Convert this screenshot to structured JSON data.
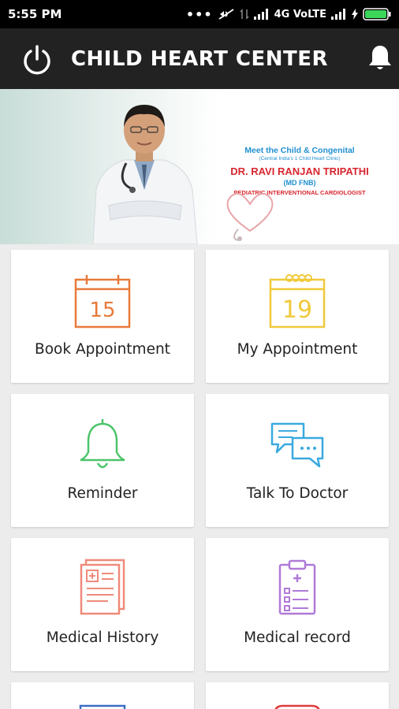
{
  "status_bar": {
    "time": "5:55 PM",
    "network": "4G VoLTE"
  },
  "app_bar": {
    "title": "CHILD HEART CENTER"
  },
  "banner": {
    "line1": "Meet the Child & Congenital",
    "line2": "(Central India's 1 Child Heart Clinic)",
    "doctor_name": "DR. RAVI RANJAN TRIPATHI",
    "qualification": "(MD FNB)",
    "specialty": "PEDIATRIC INTERVENTIONAL CARDIOLOGIST"
  },
  "tiles": [
    {
      "label": "Book Appointment",
      "icon": "calendar-15-icon",
      "icon_text": "15",
      "color": "#e87a3a"
    },
    {
      "label": "My Appointment",
      "icon": "calendar-19-icon",
      "icon_text": "19",
      "color": "#f0c93a"
    },
    {
      "label": "Reminder",
      "icon": "bell-icon",
      "color": "#4cc46a"
    },
    {
      "label": "Talk To Doctor",
      "icon": "chat-bubbles-icon",
      "color": "#3aa9e0"
    },
    {
      "label": "Medical History",
      "icon": "medical-history-icon",
      "color": "#f08a7a"
    },
    {
      "label": "Medical record",
      "icon": "clipboard-icon",
      "color": "#b07ad8"
    }
  ],
  "colors": {
    "app_bar": "#222222",
    "status_bar": "#000000",
    "background": "#ececec"
  }
}
